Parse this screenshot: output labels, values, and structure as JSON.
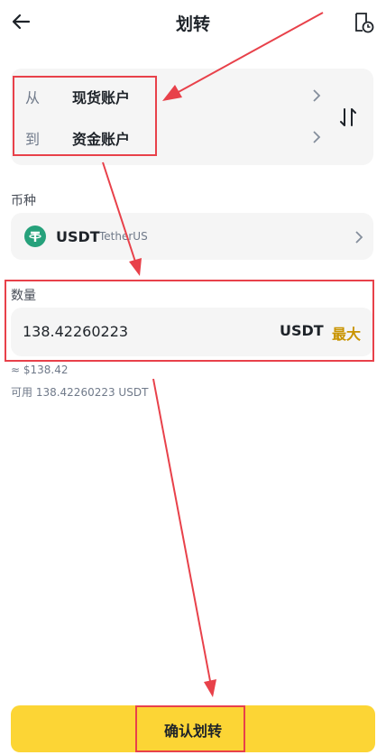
{
  "header": {
    "title": "划转",
    "back_icon": "arrow-left-icon",
    "history_icon": "transfer-history-icon"
  },
  "transfer": {
    "from_label": "从",
    "from_account": "现货账户",
    "to_label": "到",
    "to_account": "资金账户",
    "swap_icon": "swap-vertical-icon"
  },
  "coin": {
    "label": "币种",
    "symbol": "USDT",
    "name": "TetherUS",
    "icon": "tether-icon"
  },
  "amount": {
    "label": "数量",
    "value": "138.42260223",
    "unit": "USDT",
    "max_label": "最大",
    "fiat_estimate": "≈ $138.42",
    "available": "可用 138.42260223 USDT"
  },
  "confirm": {
    "label": "确认划转"
  },
  "colors": {
    "accent": "#fcd535",
    "max_text": "#c99400",
    "highlight": "#e8414a",
    "tether": "#26a17b"
  }
}
